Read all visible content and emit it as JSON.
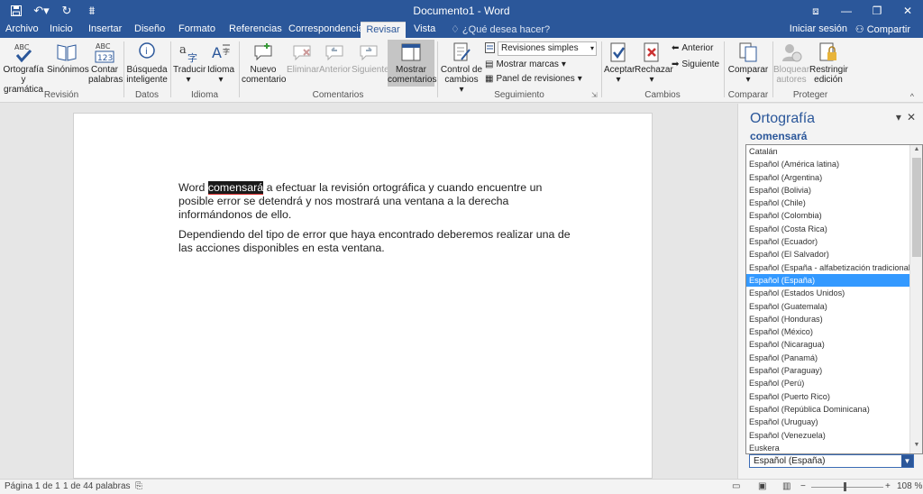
{
  "titlebar": {
    "title": "Documento1 - Word",
    "qat": {
      "save_icon": "save-icon",
      "undo_icon": "undo-icon",
      "redo_icon": "redo-icon"
    },
    "window_controls": [
      "restore-ribbon-icon",
      "minimize-icon",
      "maximize-icon",
      "close-icon"
    ]
  },
  "tabs": {
    "items": [
      "Archivo",
      "Inicio",
      "Insertar",
      "Diseño",
      "Formato",
      "Referencias",
      "Correspondencia",
      "Revisar",
      "Vista"
    ],
    "active": "Revisar",
    "tellme": "¿Qué desea hacer?",
    "signin": "Iniciar sesión",
    "share": "Compartir"
  },
  "ribbon": {
    "revision": {
      "spelling": "Ortografía y gramática",
      "synonyms": "Sinónimos",
      "count": "Contar palabras",
      "group": "Revisión"
    },
    "datos": {
      "smart": "Búsqueda inteligente",
      "group": "Datos"
    },
    "idioma": {
      "translate": "Traducir",
      "language": "Idioma",
      "group": "Idioma"
    },
    "comentarios": {
      "new": "Nuevo comentario",
      "delete": "Eliminar",
      "prev": "Anterior",
      "next": "Siguiente",
      "show": "Mostrar comentarios",
      "group": "Comentarios"
    },
    "seguimiento": {
      "track": "Control de cambios",
      "simple": "Revisiones simples",
      "marks": "Mostrar marcas",
      "panel": "Panel de revisiones",
      "group": "Seguimiento"
    },
    "cambios": {
      "accept": "Aceptar",
      "reject": "Rechazar",
      "prev": "Anterior",
      "next": "Siguiente",
      "group": "Cambios"
    },
    "comparar": {
      "compare": "Comparar",
      "group": "Comparar"
    },
    "proteger": {
      "block": "Bloquear autores",
      "restrict": "Restringir edición",
      "group": "Proteger"
    }
  },
  "document": {
    "p1_before": "Word ",
    "p1_error": "comensará",
    "p1_after": " a efectuar la revisión ortográfica y cuando encuentre un posible error se detendrá y nos mostrará una ventana a la derecha informándonos de ello.",
    "p2": "Dependiendo del tipo de error que haya encontrado deberemos realizar una de las acciones disponibles en esta ventana."
  },
  "pane": {
    "title": "Ortografía",
    "word": "comensará",
    "languages": [
      "Catalán",
      "Español (América latina)",
      "Español (Argentina)",
      "Español (Bolivia)",
      "Español (Chile)",
      "Español (Colombia)",
      "Español (Costa Rica)",
      "Español (Ecuador)",
      "Español (El Salvador)",
      "Español (España - alfabetización tradicional)",
      "Español (España)",
      "Español (Estados Unidos)",
      "Español (Guatemala)",
      "Español (Honduras)",
      "Español (México)",
      "Español (Nicaragua)",
      "Español (Panamá)",
      "Español (Paraguay)",
      "Español (Perú)",
      "Español (Puerto Rico)",
      "Español (República Dominicana)",
      "Español (Uruguay)",
      "Español (Venezuela)",
      "Euskera"
    ],
    "selected_index": 10,
    "selected_value": "Español (España)"
  },
  "status": {
    "page": "Página 1 de 1",
    "words": "1 de 44 palabras",
    "zoom": "108 %"
  },
  "colors": {
    "accent": "#2b579a",
    "selection": "#3399ff"
  }
}
